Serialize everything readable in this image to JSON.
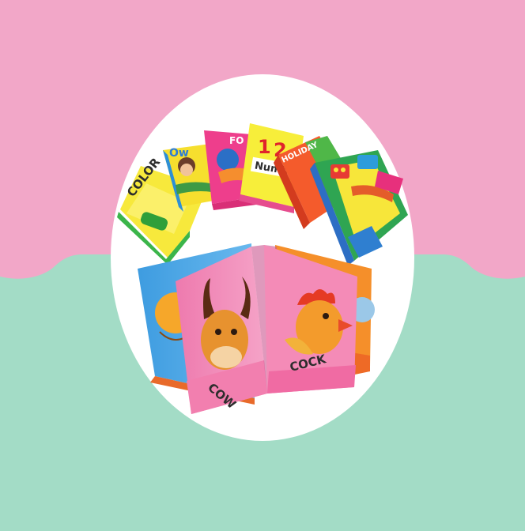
{
  "image": {
    "colors": {
      "top_background": "#F2A7C8",
      "bottom_background": "#A3DCC6",
      "oval": "#FFFFFF"
    },
    "book_labels": {
      "color": "COLOR",
      "number": "Number",
      "numeral_1": "1",
      "numeral_2": "2",
      "fo": "FO",
      "ow": "Ow",
      "holiday": "HOLIDAY",
      "cow": "COW",
      "cock": "COCK"
    }
  }
}
